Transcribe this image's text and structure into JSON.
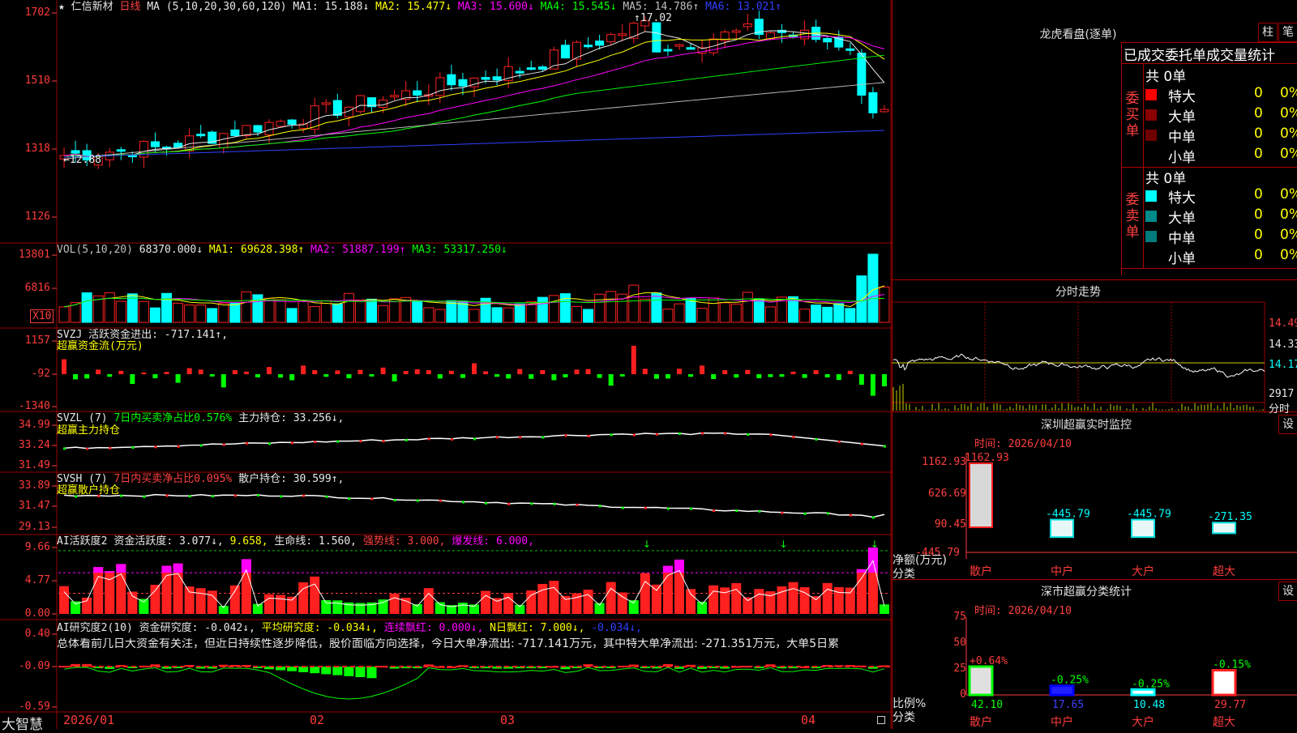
{
  "colors": {
    "up": "#ff2020",
    "down": "#00ffff",
    "bg": "#000000",
    "grid": "#9a0000"
  },
  "header": {
    "star": "★",
    "stock": "仁信新材",
    "period": "日线",
    "ma_label": "MA (5,10,20,30,60,120)",
    "ma": [
      {
        "label": "MA1: 15.188↓",
        "color": "#e8e8e8"
      },
      {
        "label": "MA2: 15.477↓",
        "color": "#ffff00"
      },
      {
        "label": "MA3: 15.600↓",
        "color": "#ff00ff"
      },
      {
        "label": "MA4: 15.545↓",
        "color": "#00ff00"
      },
      {
        "label": "MA5: 14.786↑",
        "color": "#bfbfbf"
      },
      {
        "label": "MA6: 13.021↑",
        "color": "#3040ff"
      }
    ]
  },
  "price_panel": {
    "ticks": [
      "1702",
      "1510",
      "1318",
      "1126"
    ],
    "low_mark": "←12.88",
    "high_mark": "↑17.02"
  },
  "vol_panel": {
    "label": "VOL(5,10,20)",
    "value": "68370.000↓",
    "ma1": "MA1: 69628.398↑",
    "ma2": "MA2: 51887.199↑",
    "ma3": "MA3: 53317.250↓",
    "ticks": [
      "13801",
      "6816"
    ],
    "unit": "X10"
  },
  "svzj_panel": {
    "name": "SVZJ",
    "desc": "活跃资金进出: -717.141↑,",
    "sub": "超赢资金流(万元)",
    "ticks": [
      "1157",
      "-92",
      "-1340"
    ],
    "bars": [
      520,
      -180,
      -150,
      160,
      -90,
      120,
      -340,
      60,
      -140,
      80,
      -300,
      210,
      160,
      -80,
      -460,
      140,
      90,
      -110,
      250,
      -120,
      -210,
      300,
      140,
      -90,
      130,
      -140,
      150,
      -80,
      230,
      -250,
      110,
      170,
      140,
      -150,
      120,
      -130,
      380,
      100,
      -90,
      -150,
      180,
      -160,
      140,
      -210,
      -110,
      160,
      180,
      -130,
      -400,
      -80,
      990,
      190,
      -160,
      -150,
      190,
      -90,
      300,
      -170,
      140,
      -120,
      150,
      -140,
      -100,
      -90,
      90,
      -130,
      140,
      -110,
      -200,
      120,
      -370,
      -750,
      -420
    ]
  },
  "svzl_panel": {
    "name": "SVZL (7)",
    "desc": "7日内买卖净占比0.576%",
    "hold": "主力持仓: 33.256↓,",
    "sub": "超赢主力持仓",
    "ticks": [
      "34.99",
      "33.24",
      "31.49"
    ]
  },
  "svsh_panel": {
    "name": "SVSH (7)",
    "desc": "7日内买卖净占比0.095%",
    "hold": "散户持仓: 30.599↑,",
    "sub": "超赢散户持仓",
    "ticks": [
      "33.89",
      "31.47",
      "29.13"
    ]
  },
  "ai_active_panel": {
    "name": "AI活跃度2",
    "desc": "资金活跃度: 3.077↓,",
    "v2": "9.658,",
    "life": "生命线: 1.560,",
    "strong": "强势线: 3.000,",
    "burst": "爆发线: 6.000,",
    "ticks": [
      "9.66",
      "4.77",
      "0.00"
    ]
  },
  "ai_research_panel": {
    "name": "AI研究度2(10)",
    "desc": "资金研究度: -0.042↓,",
    "avg": "平均研究度: -0.034↓,",
    "streak": "连续飘红: 0.000↓,",
    "nday": "N日飘红: 7.000↓,",
    "last": "-0.034↓,",
    "summary": "总体看前几日大资金有关注，但近日持续性逐步降低，股价面临方向选择，今日大单净流出: -717.141万元，其中特大单净流出: -271.351万元，大单5日累",
    "ticks": [
      "0.40",
      "-0.09",
      "-0.59"
    ]
  },
  "x_axis": {
    "labels": [
      "2026/01",
      "02",
      "03",
      "04"
    ]
  },
  "logo": "大智慧",
  "longhu": {
    "title": "龙虎看盘(逐单)",
    "btn1": "柱",
    "btn2": "笔",
    "tabs": "已成交委托单成交量统计",
    "buy_label": "委买单",
    "sell_label": "委卖单",
    "buy_total": "共 0单",
    "sell_total": "共 0单",
    "buy_rows": [
      {
        "name": "特大",
        "v": "0",
        "p": "0%",
        "color": "#ff0000"
      },
      {
        "name": "大单",
        "v": "0",
        "p": "0%",
        "color": "#8b0000"
      },
      {
        "name": "中单",
        "v": "0",
        "p": "0%",
        "color": "#700000"
      },
      {
        "name": "小单",
        "v": "0",
        "p": "0%",
        "color": "#000000"
      }
    ],
    "sell_rows": [
      {
        "name": "特大",
        "v": "0",
        "p": "0%",
        "color": "#00ffff"
      },
      {
        "name": "大单",
        "v": "0",
        "p": "0%",
        "color": "#008b8b"
      },
      {
        "name": "中单",
        "v": "0",
        "p": "0%",
        "color": "#007b7b"
      },
      {
        "name": "小单",
        "v": "0",
        "p": "0%",
        "color": "#000000"
      }
    ]
  },
  "intraday": {
    "title": "分时走势",
    "ticks": [
      "14.49",
      "14.33",
      "14.17"
    ],
    "vol_tick": "2917",
    "vol_unit": "分时"
  },
  "monitor": {
    "title": "深圳超赢实时监控",
    "btn": "设",
    "time": "时间: 2026/04/10",
    "yticks": [
      "1162.93",
      "626.69",
      "90.45",
      "-445.79"
    ],
    "ylabel": "净额(万元)",
    "xlabel": "分类",
    "cats": [
      "散户",
      "中户",
      "大户",
      "超大"
    ],
    "values": [
      1162.93,
      -445.79,
      -445.79,
      -271.35
    ],
    "value_labels": [
      "1162.93",
      "-445.79",
      "-445.79",
      "-271.35"
    ]
  },
  "stats": {
    "title": "深市超赢分类统计",
    "btn": "设",
    "time": "时间: 2026/04/10",
    "yticks": [
      "75",
      "50",
      "25",
      "0"
    ],
    "ylabel": "比例%",
    "xlabel": "分类",
    "cats": [
      "散户",
      "中户",
      "大户",
      "超大"
    ],
    "values": [
      42.1,
      17.65,
      10.48,
      29.77
    ],
    "value_labels": [
      "42.10",
      "17.65",
      "10.48",
      "29.77"
    ],
    "change_labels": [
      "+0.64%",
      "-0.25%",
      "-0.25%",
      "-0.15%"
    ]
  }
}
